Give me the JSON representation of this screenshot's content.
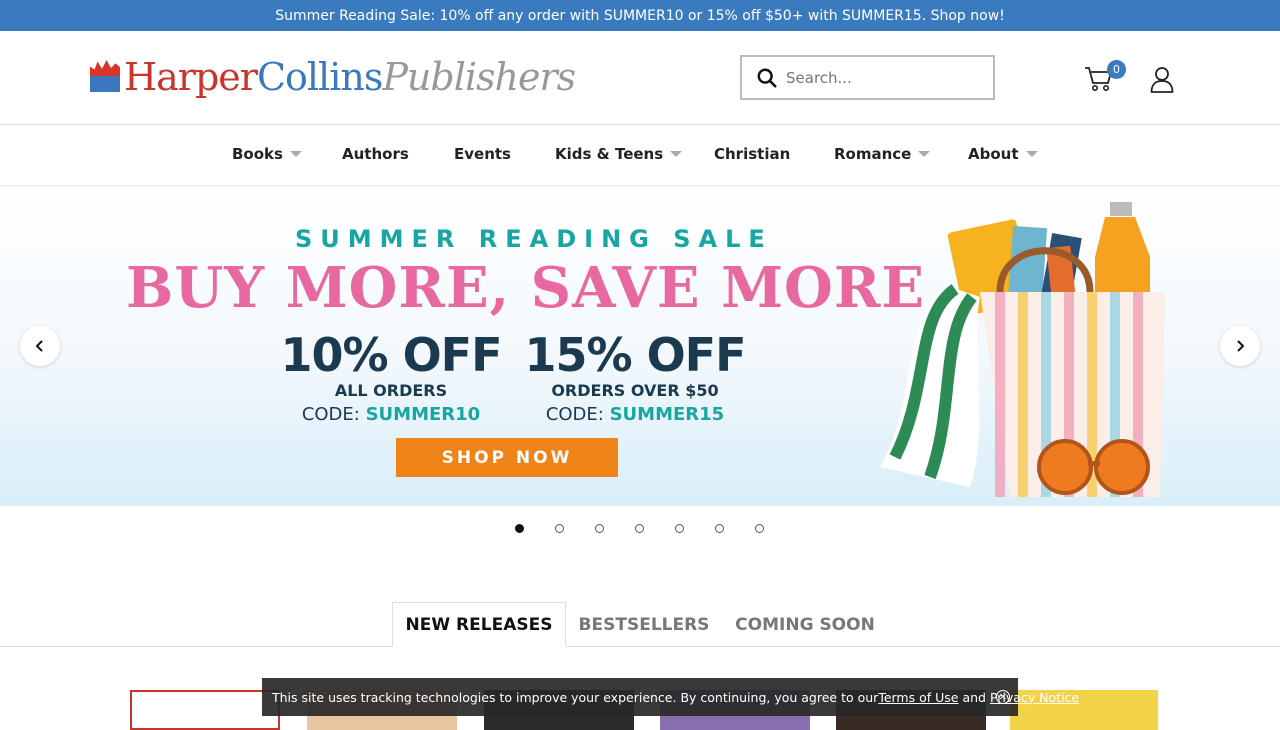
{
  "promo": {
    "text": "Summer Reading Sale: 10% off any order with SUMMER10 or 15% off $50+ with SUMMER15. Shop now!"
  },
  "header": {
    "logo": {
      "part1": "Harper",
      "part2": "Collins",
      "part3": "Publishers"
    },
    "search": {
      "placeholder": "Search..."
    },
    "cart": {
      "count": "0"
    }
  },
  "nav": {
    "items": [
      {
        "label": "Books",
        "has_dropdown": true
      },
      {
        "label": "Authors",
        "has_dropdown": false
      },
      {
        "label": "Events",
        "has_dropdown": false
      },
      {
        "label": "Kids & Teens",
        "has_dropdown": true
      },
      {
        "label": "Christian",
        "has_dropdown": false
      },
      {
        "label": "Romance",
        "has_dropdown": true
      },
      {
        "label": "About",
        "has_dropdown": true
      }
    ]
  },
  "hero": {
    "kicker": "SUMMER READING SALE",
    "headline": "BUY MORE, SAVE MORE",
    "offers": [
      {
        "percent": "10% OFF",
        "condition": "ALL ORDERS",
        "code_label": "CODE: ",
        "code": "SUMMER10"
      },
      {
        "percent": "15% OFF",
        "condition": "ORDERS OVER $50",
        "code_label": "CODE: ",
        "code": "SUMMER15"
      }
    ],
    "cta": "SHOP NOW",
    "slide_count": 7,
    "active_slide": 1
  },
  "tabs": {
    "items": [
      "NEW RELEASES",
      "BESTSELLERS",
      "COMING SOON"
    ],
    "active": 0
  },
  "cookie": {
    "text": "This site uses tracking technologies to improve your experience. By continuing, you agree to our ",
    "terms": "Terms of Use",
    "and": " and ",
    "privacy": "Privacy Notice"
  },
  "colors": {
    "promo_bar": "#3a7bbf",
    "accent_teal": "#17a6a0",
    "headline_pink": "#e8699f",
    "cta_orange": "#f08318"
  }
}
